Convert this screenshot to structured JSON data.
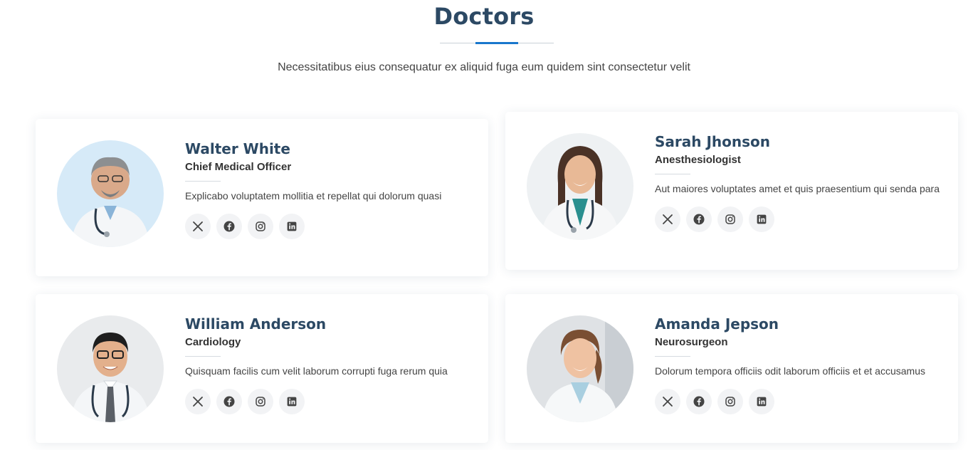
{
  "section": {
    "title": "Doctors",
    "subtitle": "Necessitatibus eius consequatur ex aliquid fuga eum quidem sint consectetur velit"
  },
  "colors": {
    "heading": "#2c4964",
    "accent": "#1977cc",
    "text": "#444444",
    "social_bg": "#f2f3f5"
  },
  "doctors": [
    {
      "name": "Walter White",
      "role": "Chief Medical Officer",
      "description": "Explicabo voluptatem mollitia et repellat qui dolorum quasi",
      "photo": "doctor-portrait-man-gray-hair"
    },
    {
      "name": "Sarah Jhonson",
      "role": "Anesthesiologist",
      "description": "Aut maiores voluptates amet et quis praesentium qui senda para",
      "photo": "doctor-portrait-woman-dark-hair"
    },
    {
      "name": "William Anderson",
      "role": "Cardiology",
      "description": "Quisquam facilis cum velit laborum corrupti fuga rerum quia",
      "photo": "doctor-portrait-man-glasses"
    },
    {
      "name": "Amanda Jepson",
      "role": "Neurosurgeon",
      "description": "Dolorum tempora officiis odit laborum officiis et et accusamus",
      "photo": "doctor-portrait-woman-ponytail"
    }
  ],
  "social_icons": [
    "x-icon",
    "facebook-icon",
    "instagram-icon",
    "linkedin-icon"
  ]
}
